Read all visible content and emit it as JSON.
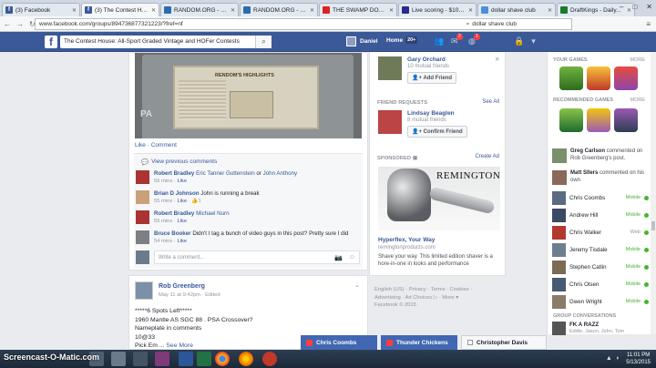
{
  "browser": {
    "tabs": [
      {
        "label": "(3) Facebook",
        "icon_color": "#3b5998",
        "active": false
      },
      {
        "label": "(3) The Contest House",
        "icon_color": "#3b5998",
        "active": true
      },
      {
        "label": "RANDOM.ORG - D...",
        "icon_color": "#2b6cb0",
        "active": false
      },
      {
        "label": "RANDOM.ORG - Li...",
        "icon_color": "#2b6cb0",
        "active": false
      },
      {
        "label": "THE SWAMP DON...",
        "icon_color": "#d22",
        "active": false
      },
      {
        "label": "Live scoring - $10K...",
        "icon_color": "#2a2a8a",
        "active": false
      },
      {
        "label": "dollar shave club",
        "icon_color": "#4a90d9",
        "active": false
      },
      {
        "label": "DraftKings - Daily...",
        "icon_color": "#1a7a2a",
        "active": false
      }
    ],
    "url": "www.facebook.com/groups/894736877321223/?fref=nf",
    "search_text": "dollar shave club"
  },
  "fb": {
    "search_value": "The Contest House: All-Sport Graded Vintage and HOFer Contests",
    "user_name": "Daniel",
    "home_label": "Home",
    "home_count": "20+",
    "notif_counts": [
      "2",
      "1"
    ]
  },
  "post1": {
    "photo_header": "RENDOM'S HIGHLIGHTS",
    "photo_watermark": "PA",
    "like_label": "Like",
    "comment_label": "Comment",
    "view_previous": "View previous comments",
    "comments": [
      {
        "name": "Robert Bradley",
        "text_tag1": "Eric Tanner Guttenstein",
        "text_mid": " or ",
        "text_tag2": "John Anthony",
        "text_plain": "",
        "time": "56 mins",
        "like": "Like",
        "likes": ""
      },
      {
        "name": "Brian D Johnson",
        "text_tag1": "",
        "text_mid": "",
        "text_tag2": "",
        "text_plain": "John is running a break",
        "time": "55 mins",
        "like": "Like",
        "likes": "1"
      },
      {
        "name": "Robert Bradley",
        "text_tag1": "Michael Nurn",
        "text_mid": "",
        "text_tag2": "",
        "text_plain": "",
        "time": "55 mins",
        "like": "Like",
        "likes": ""
      },
      {
        "name": "Bruce Booker",
        "text_tag1": "",
        "text_mid": "",
        "text_tag2": "",
        "text_plain": "Didn't I tag a bunch of video guys in this post? Pretty sure I did",
        "time": "54 mins",
        "like": "Like",
        "likes": ""
      }
    ],
    "write_placeholder": "Write a comment..."
  },
  "post2": {
    "author": "Rob Greenberg",
    "date": "May 11 at 9:42pm",
    "edited": "Edited",
    "lines": [
      "*****6 Spots Left*****",
      "1960 Mantle AS SGC 88 . PSA Crossover?",
      "Nameplate in comments",
      "10@33"
    ],
    "last_line": "Pick Em",
    "see_more": "See More"
  },
  "right": {
    "pymk_name": "Gary Orchard",
    "pymk_mutual": "10 mutual friends",
    "pymk_btn": "Add Friend",
    "fr_head": "FRIEND REQUESTS",
    "fr_see_all": "See All",
    "fr_name": "Lindsay Beaglen",
    "fr_mutual": "8 mutual friends",
    "fr_btn": "Confirm Friend",
    "sp_head": "SPONSORED",
    "sp_create": "Create Ad",
    "ad_brand": "REMINGTON",
    "ad_title": "Hyperflex, Your Way",
    "ad_url": "remingtonproducts.com",
    "ad_desc": "Shave your way. This limited edition shaver is a hore-in-one in looks and performance",
    "footer": [
      "English (US) · Privacy · Terms · Cookies ·",
      "Advertising · Ad Choices ▷ · More ▾",
      "Facebook © 2015"
    ]
  },
  "chat": {
    "your_games": "YOUR GAMES",
    "rec_games": "RECOMMENDED GAMES",
    "more": "MORE",
    "ticker": [
      {
        "name": "Greg Carlson",
        "text": " commented on Rob Greenberg's post."
      },
      {
        "name": "Matt Sllers",
        "text": " commented on his own"
      }
    ],
    "friends": [
      {
        "name": "Chris Coombs",
        "status": "Mobile"
      },
      {
        "name": "Andrew Hill",
        "status": "Mobile"
      },
      {
        "name": "Chris Walker",
        "status": "Web"
      },
      {
        "name": "Jeremy Tisdale",
        "status": "Mobile"
      },
      {
        "name": "Stephen Catlin",
        "status": "Mobile"
      },
      {
        "name": "Chris Olsen",
        "status": "Mobile"
      },
      {
        "name": "Gwen Wright",
        "status": "Mobile"
      }
    ],
    "group_head": "GROUP CONVERSATIONS",
    "group_name": "FK A RAZZ",
    "group_sub": "Eddie, Jason, John, Tom"
  },
  "chat_tabs": [
    {
      "name": "Chris Coombs"
    },
    {
      "name": "Thunder Chickens"
    },
    {
      "name": "Christopher Davis"
    }
  ],
  "taskbar": {
    "watermark": "Screencast-O-Matic.com",
    "time": "11:01 PM",
    "date": "5/13/2015"
  }
}
